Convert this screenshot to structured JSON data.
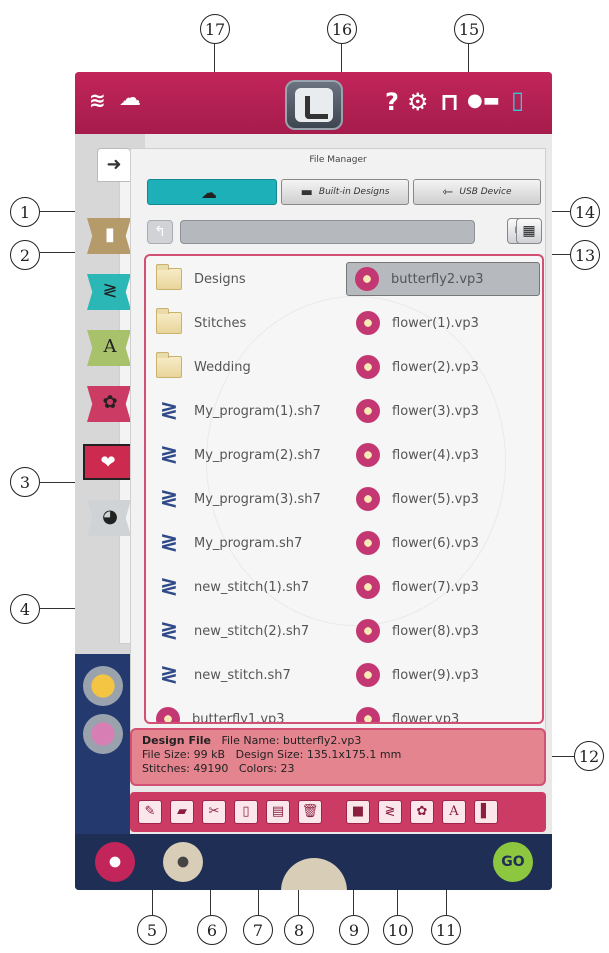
{
  "callouts": [
    "17",
    "16",
    "15",
    "1",
    "14",
    "2",
    "13",
    "3",
    "4",
    "12",
    "5",
    "6",
    "7",
    "8",
    "9",
    "10",
    "11"
  ],
  "panel": {
    "title": "File Manager",
    "sources": [
      "",
      "Built-in Designs",
      "USB Device"
    ]
  },
  "file_list": {
    "left_column": [
      {
        "name": "Designs",
        "type": "folder"
      },
      {
        "name": "Stitches",
        "type": "folder"
      },
      {
        "name": "Wedding",
        "type": "folder"
      },
      {
        "name": "My_program(1).sh7",
        "type": "stitch"
      },
      {
        "name": "My_program(2).sh7",
        "type": "stitch"
      },
      {
        "name": "My_program(3).sh7",
        "type": "stitch"
      },
      {
        "name": "My_program.sh7",
        "type": "stitch"
      },
      {
        "name": "new_stitch(1).sh7",
        "type": "stitch"
      },
      {
        "name": "new_stitch(2).sh7",
        "type": "stitch"
      },
      {
        "name": "new_stitch.sh7",
        "type": "stitch"
      },
      {
        "name": "butterfly1.vp3",
        "type": "design"
      }
    ],
    "right_column": [
      {
        "name": "butterfly2.vp3",
        "type": "design",
        "selected": true
      },
      {
        "name": "flower(1).vp3",
        "type": "design"
      },
      {
        "name": "flower(2).vp3",
        "type": "design"
      },
      {
        "name": "flower(3).vp3",
        "type": "design"
      },
      {
        "name": "flower(4).vp3",
        "type": "design"
      },
      {
        "name": "flower(5).vp3",
        "type": "design"
      },
      {
        "name": "flower(6).vp3",
        "type": "design"
      },
      {
        "name": "flower(7).vp3",
        "type": "design"
      },
      {
        "name": "flower(8).vp3",
        "type": "design"
      },
      {
        "name": "flower(9).vp3",
        "type": "design"
      },
      {
        "name": "flower.vp3",
        "type": "design"
      }
    ]
  },
  "info": {
    "type_label": "Design File",
    "file_name": "File Name: butterfly2.vp3",
    "file_size": "File Size: 99 kB",
    "design_size": "Design Size: 135.1x175.1 mm",
    "stitches": "Stitches: 49190",
    "colors": "Colors: 23"
  },
  "topbar": {
    "help": "?",
    "go": "GO"
  },
  "colors": {
    "accent": "#c2255a",
    "teal": "#1eb0b8",
    "navy": "#1b2a4a"
  }
}
